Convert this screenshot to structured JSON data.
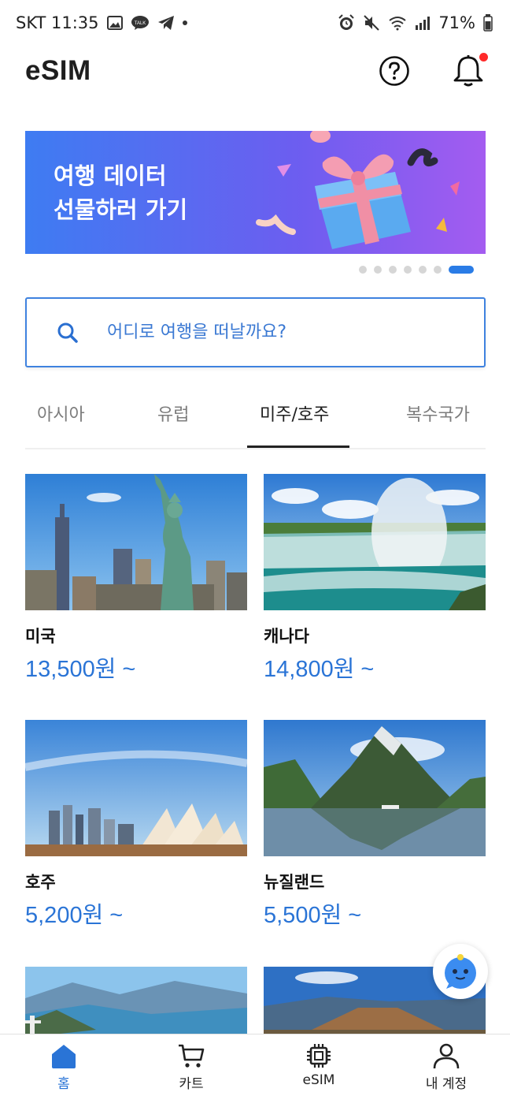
{
  "status_bar": {
    "carrier_time": "SKT 11:35",
    "battery": "71%"
  },
  "header": {
    "title": "eSIM",
    "help_icon": "question-circle-icon",
    "notification_icon": "bell-icon",
    "has_notification": true
  },
  "banner": {
    "line1": "여행 데이터",
    "line2": "선물하러 가기",
    "slide_count": 7,
    "active_slide": 7
  },
  "search": {
    "placeholder": "어디로 여행을 떠날까요?"
  },
  "tabs": [
    {
      "label": "아시아"
    },
    {
      "label": "유럽"
    },
    {
      "label": "미주/호주"
    },
    {
      "label": "복수국가"
    }
  ],
  "active_tab": "미주/호주",
  "products": [
    {
      "name": "미국",
      "price": "13,500원 ~"
    },
    {
      "name": "캐나다",
      "price": "14,800원 ~"
    },
    {
      "name": "호주",
      "price": "5,200원 ~"
    },
    {
      "name": "뉴질랜드",
      "price": "5,500원 ~"
    }
  ],
  "bottom_nav": [
    {
      "label": "홈",
      "icon": "home-icon"
    },
    {
      "label": "카트",
      "icon": "cart-icon"
    },
    {
      "label": "eSIM",
      "icon": "chip-icon"
    },
    {
      "label": "내 계정",
      "icon": "user-icon"
    }
  ],
  "colors": {
    "accent": "#2a74d6",
    "banner_start": "#3e7cf2",
    "banner_end": "#a45cf0",
    "notification": "#ff2a2a"
  }
}
